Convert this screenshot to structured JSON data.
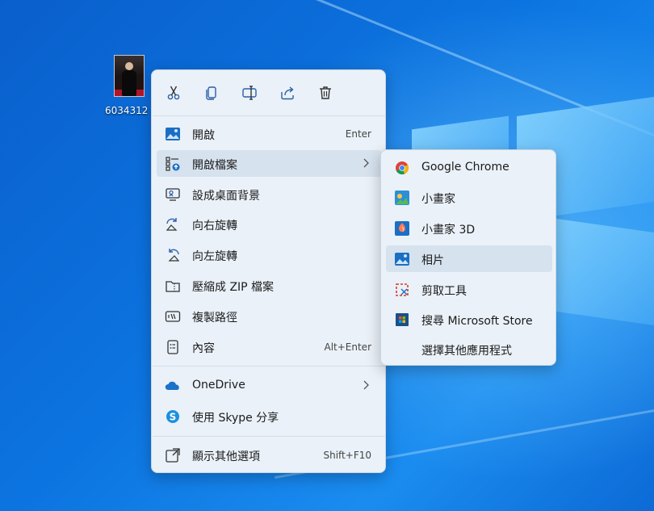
{
  "desktop": {
    "file_label": "6034312"
  },
  "toolbar": {
    "cut": "cut-icon",
    "copy": "copy-icon",
    "rename": "rename-icon",
    "share": "share-icon",
    "delete": "delete-icon"
  },
  "menu": {
    "open_label": "開啟",
    "open_shortcut": "Enter",
    "open_with_label": "開啟檔案",
    "set_background_label": "設成桌面背景",
    "rotate_right_label": "向右旋轉",
    "rotate_left_label": "向左旋轉",
    "compress_zip_label": "壓縮成 ZIP 檔案",
    "copy_path_label": "複製路徑",
    "properties_label": "內容",
    "properties_shortcut": "Alt+Enter",
    "onedrive_label": "OneDrive",
    "skype_share_label": "使用 Skype 分享",
    "more_options_label": "顯示其他選項",
    "more_options_shortcut": "Shift+F10"
  },
  "submenu": {
    "items": [
      {
        "label": "Google Chrome",
        "icon": "chrome-icon"
      },
      {
        "label": "小畫家",
        "icon": "paint-icon"
      },
      {
        "label": "小畫家 3D",
        "icon": "paint3d-icon"
      },
      {
        "label": "相片",
        "icon": "photos-icon"
      },
      {
        "label": "剪取工具",
        "icon": "snipping-tool-icon"
      },
      {
        "label": "搜尋 Microsoft Store",
        "icon": "store-icon"
      },
      {
        "label": "選擇其他應用程式",
        "icon": ""
      }
    ]
  },
  "colors": {
    "menu_bg": "#eaf1f8",
    "highlight": "#d6e2ee",
    "accent": "#1a73c8"
  }
}
